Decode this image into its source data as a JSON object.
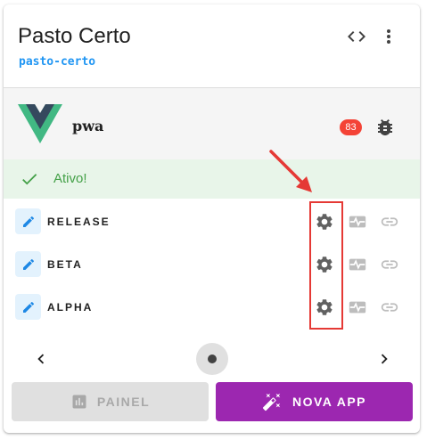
{
  "header": {
    "title": "Pasto Certo",
    "slug": "pasto-certo",
    "icons": [
      "code-icon",
      "more-vert-icon"
    ]
  },
  "app": {
    "name": "pwa",
    "logo": "vue-logo",
    "badge_count": "83",
    "icons": [
      "bug-icon"
    ]
  },
  "status": {
    "text": "Ativo!",
    "icon": "check-icon"
  },
  "channels": [
    {
      "label": "RELEASE"
    },
    {
      "label": "BETA"
    },
    {
      "label": "ALPHA"
    }
  ],
  "channel_icons": [
    "pencil-icon",
    "gear-icon",
    "pulse-icon",
    "link-icon"
  ],
  "pager": {
    "icons": [
      "chevron-left-icon",
      "dot-icon",
      "chevron-right-icon"
    ]
  },
  "actions": {
    "painel_label": "PAINEL",
    "nova_label": "NOVA APP"
  },
  "colors": {
    "accent_blue": "#2196f3",
    "badge_red": "#f44336",
    "status_green": "#43a047",
    "status_bg": "#e8f5e9",
    "nova_purple": "#9c27b0",
    "annotation_red": "#e53935"
  }
}
